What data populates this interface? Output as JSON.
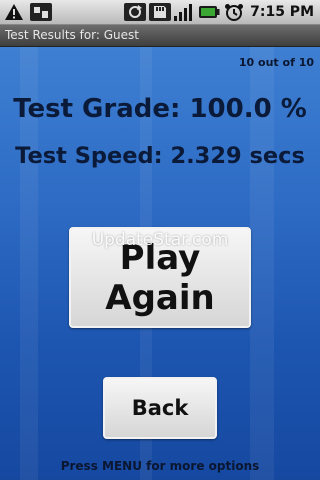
{
  "status_bar": {
    "time": "7:15 PM",
    "icons": [
      "warning-icon",
      "usb-debugging-icon",
      "sync-icon",
      "sd-card-icon",
      "signal-icon",
      "battery-icon",
      "alarm-icon"
    ]
  },
  "title_bar": {
    "title": "Test Results for: Guest"
  },
  "results": {
    "progress": "10 out of 10",
    "grade": "Test Grade: 100.0 %",
    "speed": "Test Speed: 2.329 secs"
  },
  "buttons": {
    "play_again_line1": "Play",
    "play_again_line2": "Again",
    "back": "Back"
  },
  "watermark": "UpdateStar.com",
  "footer_hint": "Press MENU for more options",
  "colors": {
    "background_top": "#3e7fd2",
    "background_bottom": "#1648a0",
    "text_dark": "#0a1a38",
    "button_face": "#e8e8e8",
    "battery_green": "#3aa832"
  }
}
